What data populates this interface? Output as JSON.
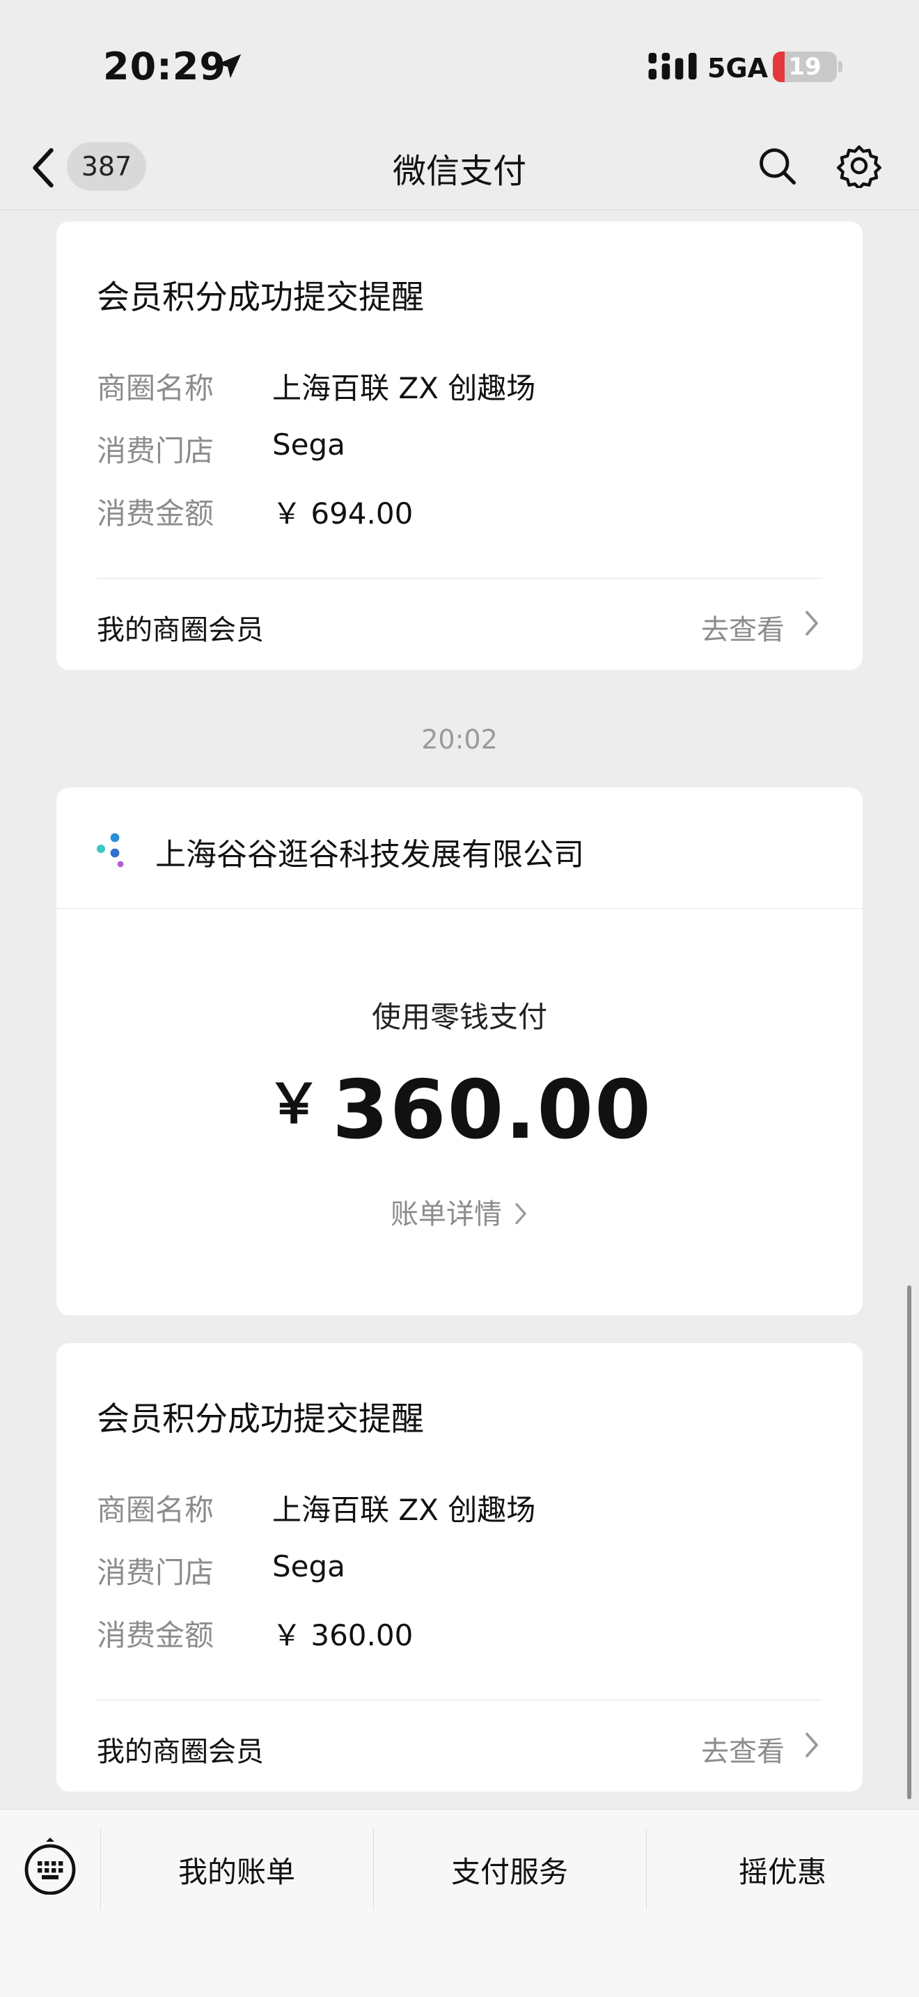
{
  "status_bar": {
    "time": "20:29",
    "network": "5GA",
    "battery_level": "19",
    "battery_fraction": 0.19
  },
  "nav": {
    "back_badge": "387",
    "title": "微信支付"
  },
  "cards": [
    {
      "title": "会员积分成功提交提醒",
      "rows": [
        {
          "label": "商圈名称",
          "value": "上海百联 ZX 创趣场"
        },
        {
          "label": "消费门店",
          "value": "Sega"
        },
        {
          "label": "消费金额",
          "value": "￥ 694.00"
        }
      ],
      "footer_left": "我的商圈会员",
      "footer_right": "去查看"
    },
    {
      "title": "会员积分成功提交提醒",
      "rows": [
        {
          "label": "商圈名称",
          "value": "上海百联 ZX 创趣场"
        },
        {
          "label": "消费门店",
          "value": "Sega"
        },
        {
          "label": "消费金额",
          "value": "￥ 360.00"
        }
      ],
      "footer_left": "我的商圈会员",
      "footer_right": "去查看"
    }
  ],
  "timestamp": "20:02",
  "payment": {
    "merchant": "上海谷谷逛谷科技发展有限公司",
    "method": "使用零钱支付",
    "currency": "￥",
    "amount": "360.00",
    "detail_link": "账单详情"
  },
  "bottom_menu": {
    "items": [
      "我的账单",
      "支付服务",
      "摇优惠"
    ]
  },
  "colors": {
    "background": "#ededed",
    "card": "#ffffff",
    "battery_low": "#e5383b",
    "muted_text": "#8c8c8c"
  },
  "icons": [
    "location-arrow-icon",
    "cellular-signal-icon",
    "back-chevron-icon",
    "search-icon",
    "gear-icon",
    "chevron-right-icon",
    "merchant-logo-icon",
    "keyboard-icon"
  ]
}
